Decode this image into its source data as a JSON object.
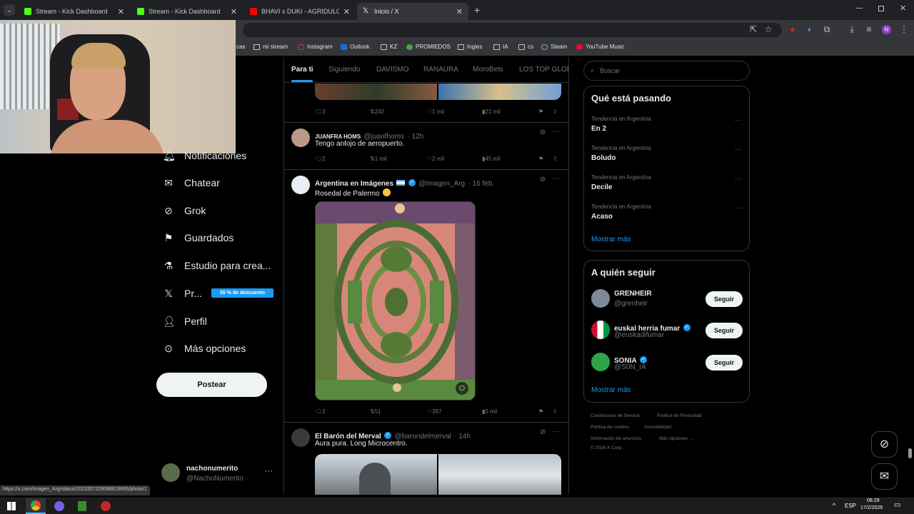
{
  "browser": {
    "tabs": [
      {
        "title": "Stream - Kick Dashboard",
        "color": "#53fc18"
      },
      {
        "title": "Stream - Kick Dashboard",
        "color": "#53fc18"
      },
      {
        "title": "BHAVI x DUKI - AGRIDULCE",
        "color": "#ff0000"
      },
      {
        "title": "Inicio / X",
        "color": "#ffffff"
      }
    ],
    "bookmarks": [
      "cas",
      "mi stream",
      "Instagram",
      "Outlook",
      "KZ",
      "PROMIEDOS",
      "Ingles",
      "IA",
      "cs",
      "Steam",
      "YouTube Music"
    ],
    "profile_initial": "N",
    "status_url": "https://x.com/Imagen_Arg/status/2023357229596819955/photo/1"
  },
  "nav": {
    "items": [
      "Notificaciones",
      "Chatear",
      "Grok",
      "Guardados",
      "Estudio para crea...",
      "Pr...",
      "Perfil",
      "Más opciones"
    ],
    "premium_badge": "50 % de descuento",
    "post_button": "Postear",
    "account_name": "nachonumerito",
    "account_handle": "@NachoNumerito"
  },
  "feed": {
    "tabs": [
      "Para ti",
      "Siguiendo",
      "DAVISMO",
      "RANAURA",
      "MoroBets",
      "LOS TOP GLOBA"
    ],
    "post0": {
      "replies": "3",
      "reposts": "242",
      "likes": "1 mil",
      "views": "21 mil"
    },
    "post1": {
      "name": "JUANFRA HOMS",
      "handle": "@juanfhoms",
      "time": "· 12h",
      "text": "Tengo antojo de aeropuerto.",
      "replies": "2",
      "reposts": "1 mil",
      "likes": "2 mil",
      "views": "45 mil"
    },
    "post2": {
      "name": "Argentina en Imágenes",
      "handle": "@Imagen_Arg",
      "time": "· 16 feb.",
      "text": "Rosedal de Palermo",
      "replies": "2",
      "reposts": "51",
      "likes": "397",
      "views": "5 mil"
    },
    "post3": {
      "name": "El Barón del Merval",
      "handle": "@barondelmerval",
      "time": "· 14h",
      "text": "Aura pura. Long Microcentro."
    }
  },
  "sidebar": {
    "search_placeholder": "Buscar",
    "trends_title": "Qué está pasando",
    "trends": [
      {
        "category": "Tendencia en Argentina",
        "name": "En 2"
      },
      {
        "category": "Tendencia en Argentina",
        "name": "Boludo"
      },
      {
        "category": "Tendencia en Argentina",
        "name": "Decile"
      },
      {
        "category": "Tendencia en Argentina",
        "name": "Acaso"
      }
    ],
    "show_more": "Mostrar más",
    "follow_title": "A quién seguir",
    "follow": [
      {
        "name": "GRENHEIR",
        "handle": "@grenheir"
      },
      {
        "name": "euskal herria fumar",
        "handle": "@euskadifumar"
      },
      {
        "name": "SONIA",
        "handle": "@S0N_IA"
      }
    ],
    "follow_button": "Seguir",
    "show_more2": "Mostrar más",
    "footer": [
      "Condiciones de Servicio",
      "Política de Privacidad",
      "Política de cookies",
      "Accesibilidad",
      "Información de anuncios",
      "Más opciones ...",
      "© 2026 X Corp."
    ]
  },
  "taskbar": {
    "lang": "ESP",
    "time": "08:29",
    "date": "17/2/2026"
  }
}
